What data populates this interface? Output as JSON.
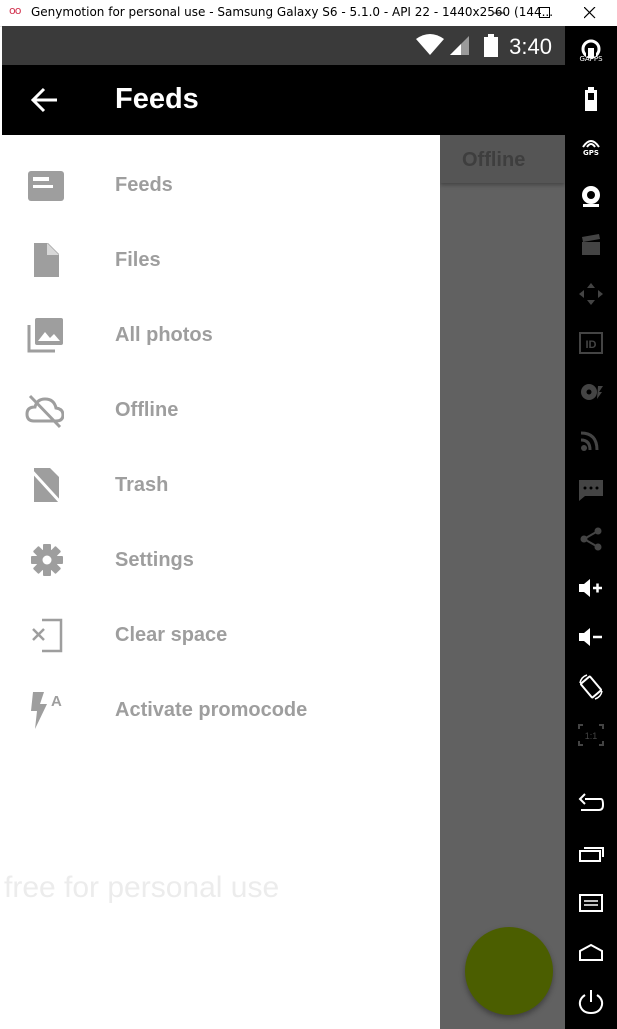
{
  "window": {
    "title": "Genymotion for personal use - Samsung Galaxy S6 - 5.1.0 - API 22 - 1440x2560 (144...",
    "logo_text": "oo"
  },
  "statusbar": {
    "time": "3:40"
  },
  "appbar": {
    "title": "Feeds"
  },
  "background": {
    "tab_label": "Offline",
    "fab_color": "#4b5e00"
  },
  "drawer": {
    "items": [
      {
        "label": "Feeds",
        "icon": "feed-icon"
      },
      {
        "label": "Files",
        "icon": "file-icon"
      },
      {
        "label": "All photos",
        "icon": "photos-icon"
      },
      {
        "label": "Offline",
        "icon": "cloud-off-icon"
      },
      {
        "label": "Trash",
        "icon": "trash-icon"
      },
      {
        "label": "Settings",
        "icon": "gear-icon"
      },
      {
        "label": "Clear space",
        "icon": "clear-space-icon"
      },
      {
        "label": "Activate promocode",
        "icon": "promocode-icon"
      }
    ]
  },
  "watermark": "free for personal use",
  "sidebar": {
    "gapps_label": "GAPPS",
    "gps_label": "GPS",
    "id_label": "ID",
    "scale_label": "1:1"
  },
  "colors": {
    "appbar": "#000000",
    "drawer_text": "#9e9e9e",
    "scrim": "#616161"
  }
}
